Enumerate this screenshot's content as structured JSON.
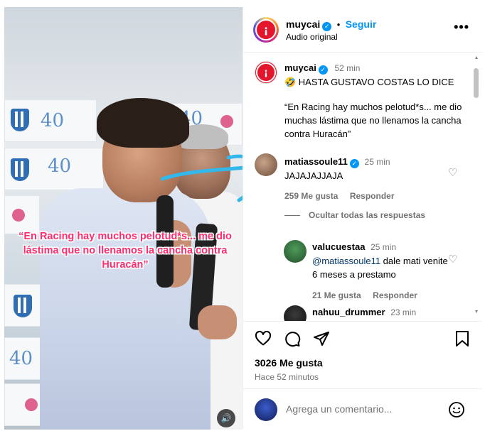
{
  "post": {
    "username": "muycai",
    "follow_label": "Seguir",
    "audio": "Audio original",
    "time": "52 min",
    "caption_line1": "🤣 HASTA GUSTAVO COSTAS LO DICE",
    "caption_quote": "“En Racing hay muchos pelotud*s... me dio muchas lástima que no llenamos la cancha contra Huracán”",
    "video_caption": "“En Racing hay muchos pelotud*s... me dio lástima que no llenamos la cancha contra Huracán”",
    "banner_number": "40",
    "likes": "3026 Me gusta",
    "posted_ago": "Hace 52 minutos",
    "comment_placeholder": "Agrega un comentario..."
  },
  "comments": [
    {
      "user": "matiassoule11",
      "time": "25 min",
      "text": "JAJAJAJJAJA",
      "likes": "259 Me gusta",
      "reply_label": "Responder",
      "hide_replies": "Ocultar todas las respuestas"
    },
    {
      "user": "valucuestaa",
      "time": "25 min",
      "mention": "@matiassoule11",
      "text": " dale mati venite 6 meses a prestamo",
      "likes": "21 Me gusta",
      "reply_label": "Responder"
    },
    {
      "user": "nahuu_drummer",
      "time": "23 min"
    }
  ],
  "icons": {
    "verified": "verified-badge-icon",
    "more": "more-options-icon",
    "heart": "heart-icon",
    "comment": "comment-icon",
    "share": "share-icon",
    "save": "bookmark-icon",
    "emoji": "emoji-icon",
    "sound": "speaker-icon"
  },
  "colors": {
    "accent": "#0095f6",
    "caption_pink": "#ff2d6e",
    "brand_red": "#e4162c",
    "arrow": "#32b8ea"
  }
}
